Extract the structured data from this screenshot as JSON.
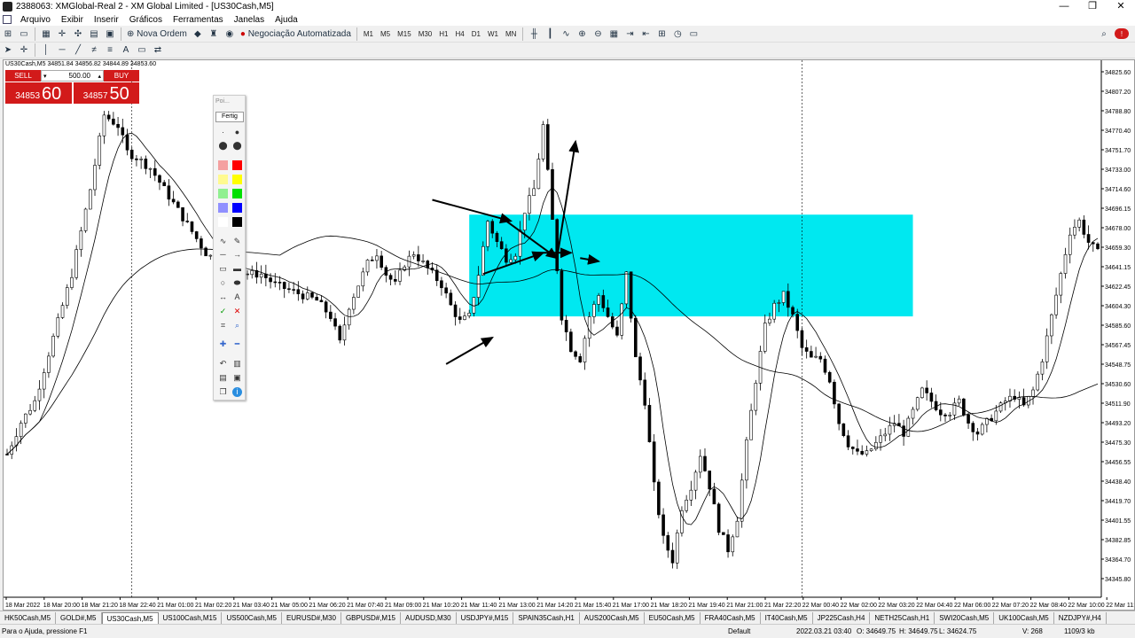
{
  "window": {
    "title": "2388063: XMGlobal-Real 2 - XM Global Limited - [US30Cash,M5]",
    "controls": [
      "—",
      "❐",
      "✕"
    ]
  },
  "menu": [
    "Arquivo",
    "Exibir",
    "Inserir",
    "Gráficos",
    "Ferramentas",
    "Janelas",
    "Ajuda"
  ],
  "toolbar": {
    "new_order": "Nova Ordem",
    "auto_trading": "Negociação Automatizada",
    "timeframes": [
      "M1",
      "M5",
      "M15",
      "M30",
      "H1",
      "H4",
      "D1",
      "W1",
      "MN"
    ]
  },
  "chart": {
    "header": "US30Cash,M5  34851.84 34856.82 34844.89 34853.60",
    "trade_panel": {
      "sell_label": "SELL",
      "buy_label": "BUY",
      "lot": "500.00",
      "sell_small": "34853",
      "sell_big": "60",
      "buy_small": "34857",
      "buy_big": "50"
    }
  },
  "chart_data": {
    "type": "candlestick",
    "symbol": "US30Cash",
    "timeframe": "M5",
    "y_ticks": [
      "34825.60",
      "34807.20",
      "34788.80",
      "34770.40",
      "34751.70",
      "34733.00",
      "34714.60",
      "34696.15",
      "34678.00",
      "34659.30",
      "34641.15",
      "34622.45",
      "34604.30",
      "34585.60",
      "34567.45",
      "34548.75",
      "34530.60",
      "34511.90",
      "34493.20",
      "34475.30",
      "34456.55",
      "34438.40",
      "34419.70",
      "34401.55",
      "34382.85",
      "34364.70",
      "34345.80"
    ],
    "x_ticks": [
      "18 Mar 2022",
      "18 Mar 20:00",
      "18 Mar 21:20",
      "18 Mar 22:40",
      "21 Mar 01:00",
      "21 Mar 02:20",
      "21 Mar 03:40",
      "21 Mar 05:00",
      "21 Mar 06:20",
      "21 Mar 07:40",
      "21 Mar 09:00",
      "21 Mar 10:20",
      "21 Mar 11:40",
      "21 Mar 13:00",
      "21 Mar 14:20",
      "21 Mar 15:40",
      "21 Mar 17:00",
      "21 Mar 18:20",
      "21 Mar 19:40",
      "21 Mar 21:00",
      "21 Mar 22:20",
      "22 Mar 00:40",
      "22 Mar 02:00",
      "22 Mar 03:20",
      "22 Mar 04:40",
      "22 Mar 06:00",
      "22 Mar 07:20",
      "22 Mar 08:40",
      "22 Mar 10:00",
      "22 Mar 11:20"
    ],
    "ylim": [
      34335,
      34840
    ],
    "path_points": [
      [
        0,
        34470
      ],
      [
        3,
        34500
      ],
      [
        6,
        34520
      ],
      [
        10,
        34580
      ],
      [
        14,
        34640
      ],
      [
        18,
        34720
      ],
      [
        21,
        34790
      ],
      [
        24,
        34780
      ],
      [
        26,
        34755
      ],
      [
        28,
        34750
      ],
      [
        31,
        34740
      ],
      [
        34,
        34720
      ],
      [
        37,
        34700
      ],
      [
        40,
        34680
      ],
      [
        43,
        34660
      ],
      [
        46,
        34650
      ],
      [
        49,
        34645
      ],
      [
        52,
        34640
      ],
      [
        55,
        34640
      ],
      [
        58,
        34630
      ],
      [
        61,
        34625
      ],
      [
        64,
        34620
      ],
      [
        67,
        34615
      ],
      [
        70,
        34600
      ],
      [
        72,
        34575
      ],
      [
        74,
        34610
      ],
      [
        76,
        34630
      ],
      [
        78,
        34650
      ],
      [
        80,
        34660
      ],
      [
        82,
        34640
      ],
      [
        84,
        34630
      ],
      [
        86,
        34650
      ],
      [
        88,
        34660
      ],
      [
        90,
        34650
      ],
      [
        92,
        34640
      ],
      [
        94,
        34630
      ],
      [
        96,
        34610
      ],
      [
        98,
        34595
      ],
      [
        100,
        34600
      ],
      [
        102,
        34640
      ],
      [
        104,
        34690
      ],
      [
        106,
        34670
      ],
      [
        108,
        34655
      ],
      [
        110,
        34660
      ],
      [
        112,
        34700
      ],
      [
        114,
        34720
      ],
      [
        116,
        34780
      ],
      [
        118,
        34690
      ],
      [
        120,
        34600
      ],
      [
        122,
        34570
      ],
      [
        124,
        34560
      ],
      [
        126,
        34600
      ],
      [
        128,
        34620
      ],
      [
        130,
        34600
      ],
      [
        132,
        34580
      ],
      [
        134,
        34640
      ],
      [
        136,
        34560
      ],
      [
        138,
        34520
      ],
      [
        140,
        34440
      ],
      [
        142,
        34390
      ],
      [
        144,
        34370
      ],
      [
        146,
        34420
      ],
      [
        148,
        34440
      ],
      [
        150,
        34470
      ],
      [
        152,
        34440
      ],
      [
        154,
        34400
      ],
      [
        156,
        34380
      ],
      [
        158,
        34410
      ],
      [
        160,
        34480
      ],
      [
        162,
        34540
      ],
      [
        164,
        34590
      ],
      [
        166,
        34610
      ],
      [
        168,
        34620
      ],
      [
        170,
        34600
      ],
      [
        172,
        34570
      ],
      [
        174,
        34560
      ],
      [
        176,
        34560
      ],
      [
        178,
        34540
      ],
      [
        180,
        34500
      ],
      [
        182,
        34480
      ],
      [
        184,
        34470
      ],
      [
        186,
        34470
      ],
      [
        188,
        34480
      ],
      [
        190,
        34490
      ],
      [
        192,
        34500
      ],
      [
        194,
        34490
      ],
      [
        196,
        34510
      ],
      [
        198,
        34530
      ],
      [
        200,
        34520
      ],
      [
        202,
        34510
      ],
      [
        204,
        34510
      ],
      [
        206,
        34520
      ],
      [
        208,
        34500
      ],
      [
        210,
        34490
      ],
      [
        212,
        34500
      ],
      [
        214,
        34510
      ],
      [
        216,
        34520
      ],
      [
        218,
        34525
      ],
      [
        220,
        34515
      ],
      [
        222,
        34530
      ],
      [
        224,
        34560
      ],
      [
        226,
        34600
      ],
      [
        228,
        34640
      ],
      [
        230,
        34680
      ],
      [
        232,
        34690
      ],
      [
        234,
        34670
      ],
      [
        236,
        34660
      ]
    ]
  },
  "palette": {
    "placeholder": "Poi...",
    "done": "Fertig"
  },
  "tabs": [
    "HK50Cash,M5",
    "GOLD#,M5",
    "US30Cash,M5",
    "US100Cash,M15",
    "US500Cash,M5",
    "EURUSD#,M30",
    "GBPUSD#,M15",
    "AUDUSD,M30",
    "USDJPY#,M15",
    "SPAIN35Cash,H1",
    "AUS200Cash,M5",
    "EU50Cash,M5",
    "FRA40Cash,M5",
    "IT40Cash,M5",
    "JP225Cash,H4",
    "NETH25Cash,H1",
    "SWI20Cash,M5",
    "UK100Cash,M5",
    "NZDJPY#,H4"
  ],
  "status": {
    "help": "Para o Ajuda, pressione F1",
    "profile": "Default",
    "time": "2022.03.21 03:40",
    "open": "O: 34649.75",
    "high": "H: 34649.75",
    "low": "L: 34624.75",
    "volume": "V: 268",
    "traffic": "1109/3 kb"
  },
  "colors": {
    "box": "#00e8f0",
    "candle": "#000000",
    "sell": "#d21a1a"
  }
}
